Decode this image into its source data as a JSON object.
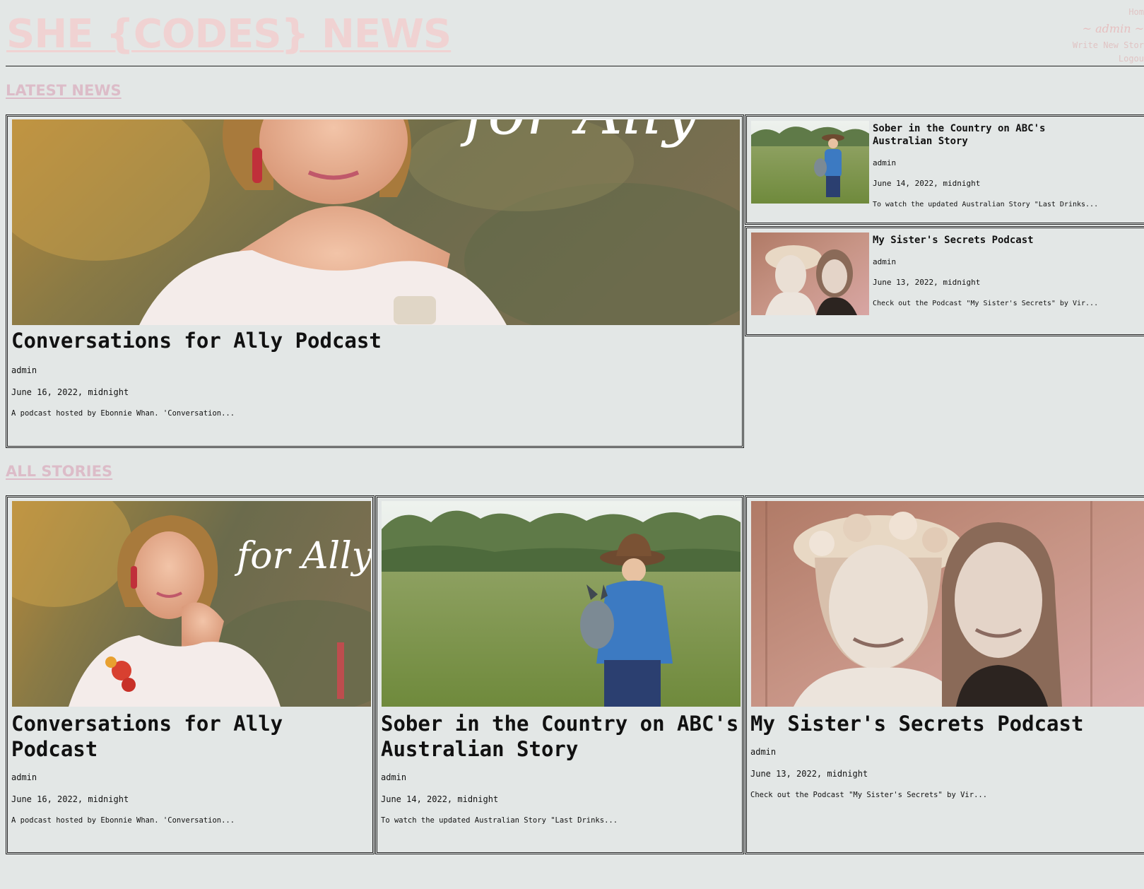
{
  "site": {
    "title": "SHE {CODES} NEWS"
  },
  "nav": {
    "home": "Hom",
    "user": "~ admin ~",
    "write_story": "Write New Stor",
    "logout": "Logou"
  },
  "sections": {
    "latest": "LATEST NEWS",
    "all": "ALL STORIES"
  },
  "latest": {
    "featured": {
      "title": "Conversations for Ally Podcast",
      "author": "admin",
      "date": "June 16, 2022, midnight",
      "excerpt": "A podcast hosted by Ebonnie Whan. 'Conversation...",
      "image_text": "for Ally"
    },
    "side": [
      {
        "title": "Sober in the Country on ABC's Australian Story",
        "author": "admin",
        "date": "June 14, 2022, midnight",
        "excerpt": "To watch the updated Australian Story \"Last Drinks..."
      },
      {
        "title": "My Sister's Secrets Podcast",
        "author": "admin",
        "date": "June 13, 2022, midnight",
        "excerpt": "Check out the Podcast \"My Sister's Secrets\" by Vir..."
      }
    ]
  },
  "stories": [
    {
      "title": "Conversations for Ally Podcast",
      "author": "admin",
      "date": "June 16, 2022, midnight",
      "excerpt": "A podcast hosted by Ebonnie Whan. 'Conversation...",
      "image_text": "for Ally"
    },
    {
      "title": "Sober in the Country on ABC's Australian Story",
      "author": "admin",
      "date": "June 14, 2022, midnight",
      "excerpt": "To watch the updated Australian Story \"Last Drinks..."
    },
    {
      "title": "My Sister's Secrets Podcast",
      "author": "admin",
      "date": "June 13, 2022, midnight",
      "excerpt": "Check out the Podcast \"My Sister's Secrets\" by Vir..."
    }
  ],
  "colors": {
    "background": "#e3e7e6",
    "site_title": "#f0d2d2",
    "section_heading": "#dcbcc8",
    "border": "#222222"
  }
}
